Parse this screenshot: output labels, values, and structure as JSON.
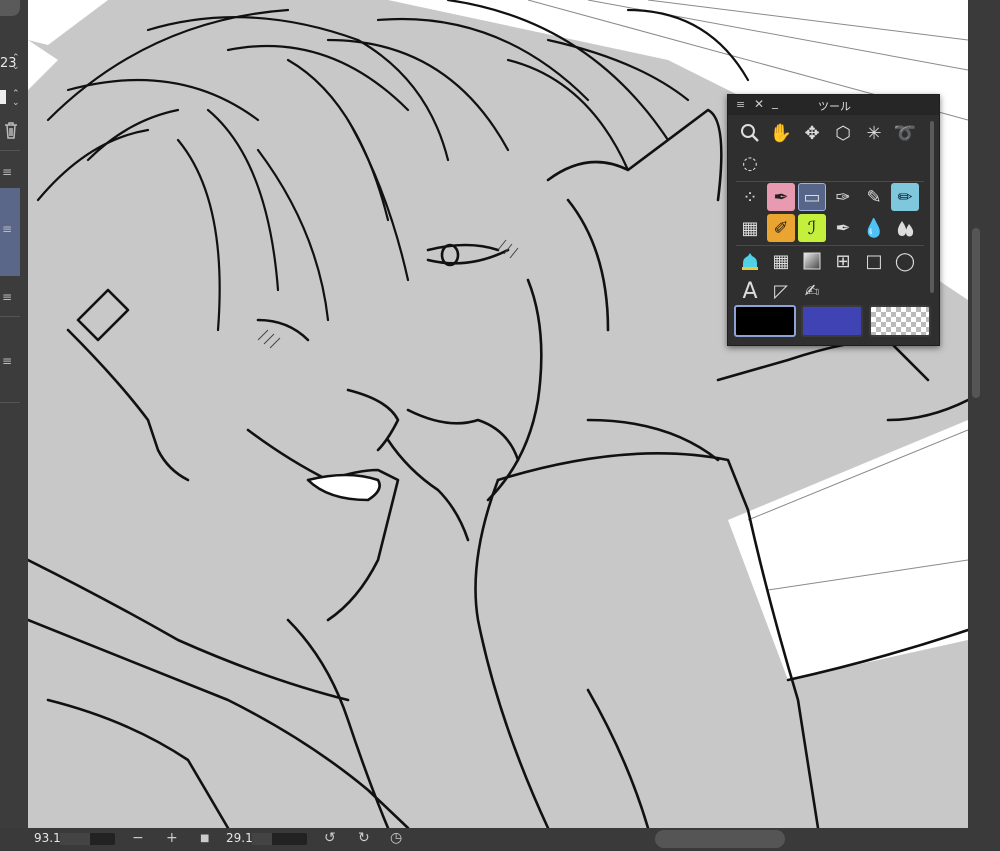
{
  "left_panel": {
    "size_value": "23",
    "items": [
      "≡",
      "≡",
      "≡",
      "≡"
    ]
  },
  "palette": {
    "title": "ツール",
    "menu_glyph": "≡",
    "close_glyph": "✕",
    "min_glyph": "_",
    "tools": [
      {
        "name": "zoom-tool-icon",
        "glyph": "🔍"
      },
      {
        "name": "hand-tool-icon",
        "glyph": "✋"
      },
      {
        "name": "move-tool-icon",
        "glyph": "✥"
      },
      {
        "name": "object-tool-icon",
        "glyph": "⬡"
      },
      {
        "name": "magic-wand-tool-icon",
        "glyph": "✳"
      },
      {
        "name": "lasso-tool-icon",
        "glyph": "➰"
      },
      {
        "name": "selection-lasso-tool-icon",
        "glyph": "◌"
      },
      {
        "name": "airbrush-tool-icon",
        "glyph": "⁘"
      },
      {
        "name": "pen-tool-icon",
        "glyph": "✒"
      },
      {
        "name": "eraser-tool-icon",
        "glyph": "▭"
      },
      {
        "name": "ink-pen-tool-icon",
        "glyph": "✑"
      },
      {
        "name": "marker-tool-icon",
        "glyph": "✎"
      },
      {
        "name": "pencil-tool-icon",
        "glyph": "✏"
      },
      {
        "name": "decoration-tool-icon",
        "glyph": "▦"
      },
      {
        "name": "highlighter-tool-icon",
        "glyph": "✐"
      },
      {
        "name": "dropper-tool-icon",
        "glyph": "ℐ"
      },
      {
        "name": "liquify-tool-icon",
        "glyph": "✒"
      },
      {
        "name": "blend-tool-icon",
        "glyph": "💧"
      },
      {
        "name": "fill-tool-icon",
        "glyph": "⛲"
      },
      {
        "name": "ruler-tool-icon",
        "glyph": "▦"
      },
      {
        "name": "gradient-tool-icon",
        "glyph": "▣"
      },
      {
        "name": "frame-tool-icon",
        "glyph": "⊞"
      },
      {
        "name": "rectangle-tool-icon",
        "glyph": "□"
      },
      {
        "name": "balloon-tool-icon",
        "glyph": "◯"
      },
      {
        "name": "text-tool-icon",
        "glyph": "A"
      },
      {
        "name": "panel-tool-icon",
        "glyph": "◸"
      },
      {
        "name": "correction-tool-icon",
        "glyph": "✍"
      }
    ]
  },
  "statusbar": {
    "zoom": "93.1",
    "minus": "−",
    "plus": "+",
    "rotation": "29.1"
  },
  "colors": {
    "main": "#000000",
    "sub": "#3f43b4",
    "accent": "#8da2d6",
    "canvas_fill": "#c8c8c8"
  }
}
